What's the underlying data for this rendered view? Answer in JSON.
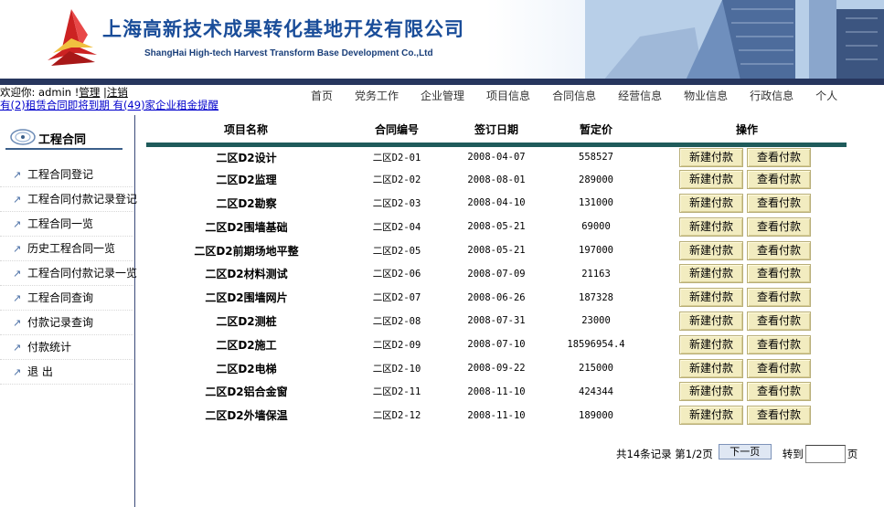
{
  "header": {
    "company_cn": "上海高新技术成果转化基地开发有限公司",
    "company_en": "ShangHai High-tech Harvest Transform Base Development Co.,Ltd"
  },
  "userbar": {
    "welcome": "欢迎你: admin !",
    "manage": "管理",
    "sep": " |",
    "logout": "注销",
    "notice": "有(2)租赁合同即将到期 有(49)家企业租金提醒"
  },
  "nav": [
    "首页",
    "党务工作",
    "企业管理",
    "项目信息",
    "合同信息",
    "经营信息",
    "物业信息",
    "行政信息",
    "个人"
  ],
  "sidebar": {
    "title": "工程合同",
    "items": [
      "工程合同登记",
      "工程合同付款记录登记",
      "工程合同一览",
      "历史工程合同一览",
      "工程合同付款记录一览",
      "工程合同查询",
      "付款记录查询",
      "付款统计",
      "退 出"
    ]
  },
  "table": {
    "headers": [
      "项目名称",
      "合同编号",
      "签订日期",
      "暂定价",
      "操作"
    ],
    "rows": [
      {
        "name": "二区D2设计",
        "code": "二区D2-01",
        "date": "2008-04-07",
        "price": "558527"
      },
      {
        "name": "二区D2监理",
        "code": "二区D2-02",
        "date": "2008-08-01",
        "price": "289000"
      },
      {
        "name": "二区D2勘察",
        "code": "二区D2-03",
        "date": "2008-04-10",
        "price": "131000"
      },
      {
        "name": "二区D2围墙基础",
        "code": "二区D2-04",
        "date": "2008-05-21",
        "price": "69000"
      },
      {
        "name": "二区D2前期场地平整",
        "code": "二区D2-05",
        "date": "2008-05-21",
        "price": "197000"
      },
      {
        "name": "二区D2材料测试",
        "code": "二区D2-06",
        "date": "2008-07-09",
        "price": "21163"
      },
      {
        "name": "二区D2围墙网片",
        "code": "二区D2-07",
        "date": "2008-06-26",
        "price": "187328"
      },
      {
        "name": "二区D2测桩",
        "code": "二区D2-08",
        "date": "2008-07-31",
        "price": "23000"
      },
      {
        "name": "二区D2施工",
        "code": "二区D2-09",
        "date": "2008-07-10",
        "price": "18596954.4"
      },
      {
        "name": "二区D2电梯",
        "code": "二区D2-10",
        "date": "2008-09-22",
        "price": "215000"
      },
      {
        "name": "二区D2铝合金窗",
        "code": "二区D2-11",
        "date": "2008-11-10",
        "price": "424344"
      },
      {
        "name": "二区D2外墙保温",
        "code": "二区D2-12",
        "date": "2008-11-10",
        "price": "189000"
      }
    ],
    "btn_new": "新建付款",
    "btn_view": "查看付款"
  },
  "pager": {
    "summary": "共14条记录 第1/2页",
    "next": "下一页",
    "goto": "转到",
    "page_suffix": "页",
    "input_value": ""
  }
}
